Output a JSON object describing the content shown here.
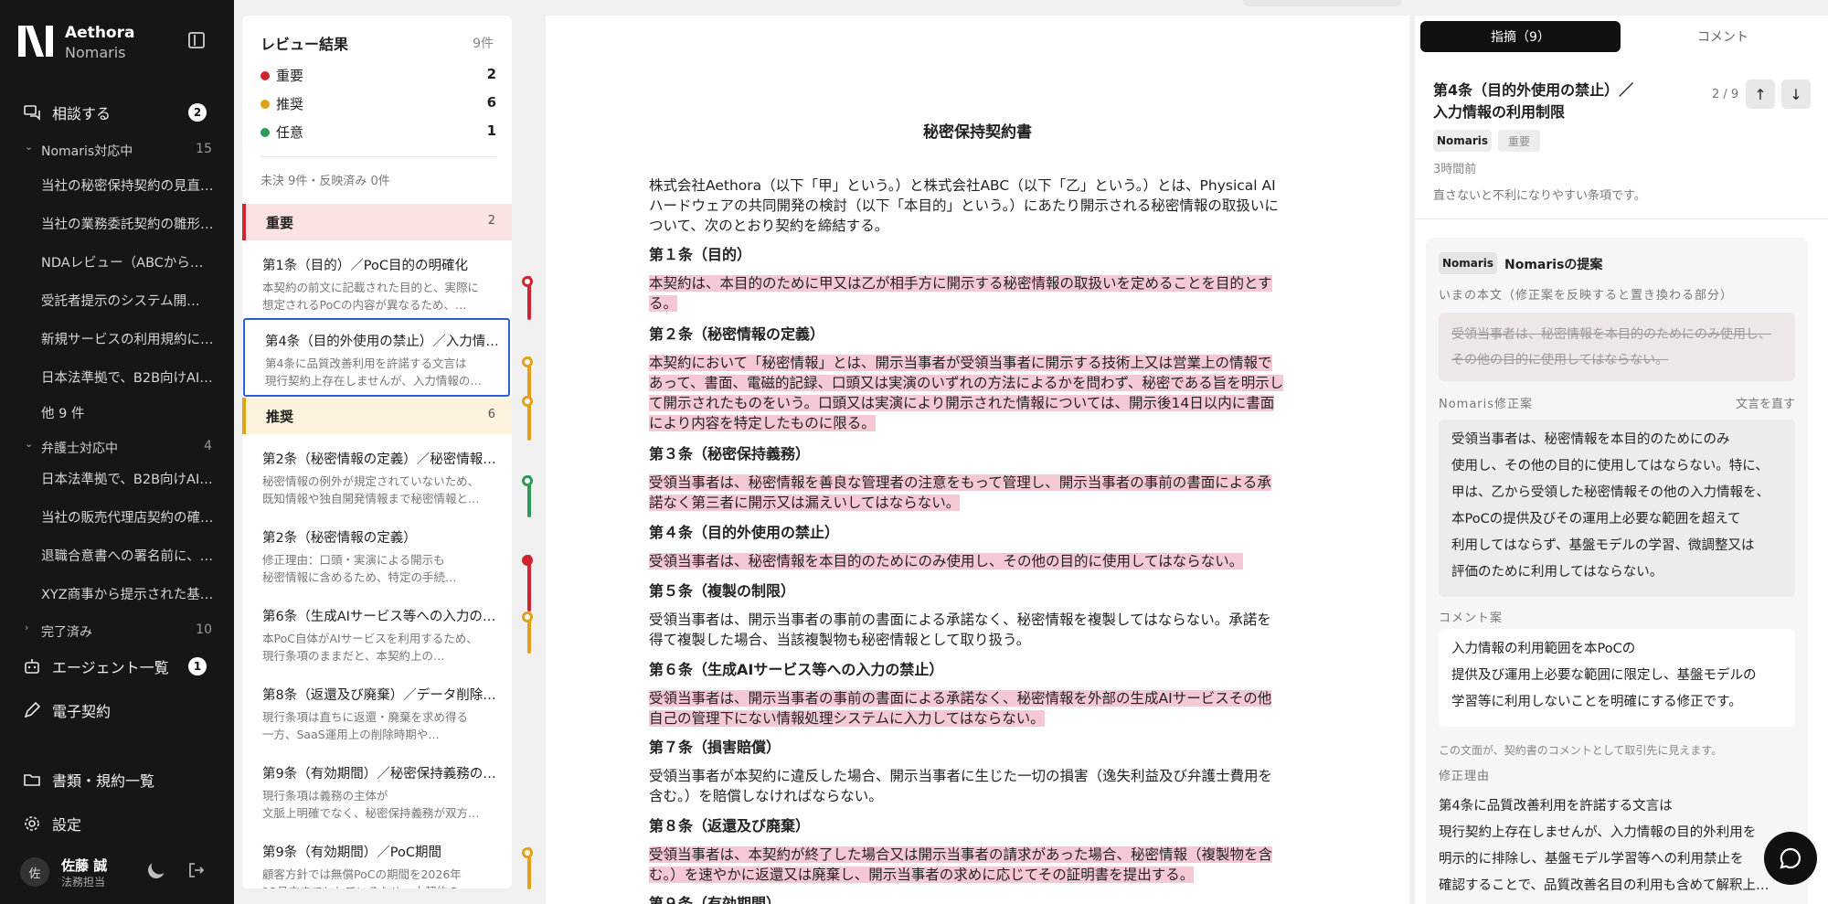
{
  "brand": {
    "name": "Aethora",
    "sub": "Nomaris"
  },
  "nav": {
    "consult": "相談する",
    "consult_badge": "2",
    "agents": "エージェント一覧",
    "agents_badge": "1",
    "contract": "電子契約",
    "docs": "書類・規約一覧",
    "settings": "設定"
  },
  "groups": [
    {
      "label": "Nomaris対応中",
      "count": "15",
      "items": [
        "当社の秘密保持契約の見直…",
        "当社の業務委託契約の雛形…",
        "NDAレビュー（ABCからの…",
        "受託者提示のシステム開…",
        "新規サービスの利用規約に…",
        "日本法準拠で、B2B向けAI…",
        "他 9 件"
      ]
    },
    {
      "label": "弁護士対応中",
      "count": "4",
      "items": [
        "日本法準拠で、B2B向けAI…",
        "当社の販売代理店契約の確…",
        "退職合意書への署名前に、…",
        "XYZ商事から提示された基…"
      ]
    },
    {
      "label": "完了済み",
      "count": "10",
      "items": []
    }
  ],
  "user": {
    "avatar": "佐",
    "name": "佐藤 誠",
    "role": "法務担当"
  },
  "review": {
    "title": "レビュー結果",
    "count": "9件",
    "severity": [
      {
        "label": "重要",
        "count": "2",
        "color": "#d0252f"
      },
      {
        "label": "推奨",
        "count": "6",
        "color": "#e0a21b"
      },
      {
        "label": "任意",
        "count": "1",
        "color": "#2e9a5a"
      }
    ],
    "status": "未決 9件・反映済み 0件",
    "sections": [
      {
        "label": "重要",
        "count": "2"
      },
      {
        "label": "推奨",
        "count": "6"
      }
    ],
    "items": [
      {
        "title": "第1条（目的）／PoC目的の明確化",
        "desc": "本契約の前文に記載された目的と、実際に\n想定されるPoCの内容が異なるため、…"
      },
      {
        "title": "第4条（目的外使用の禁止）／入力情…",
        "desc": "第4条に品質改善利用を許諾する文言は\n現行契約上存在しませんが、入力情報の…"
      },
      {
        "title": "第2条（秘密情報の定義）／秘密情報…",
        "desc": "秘密情報の例外が規定されていないため、\n既知情報や独自開発情報まで秘密情報と…"
      },
      {
        "title": "第2条（秘密情報の定義）",
        "desc": "修正理由：口頭・実演による開示も\n秘密情報に含めるため、特定の手続…"
      },
      {
        "title": "第6条（生成AIサービス等への入力の…",
        "desc": "本PoC自体がAIサービスを利用するため、\n現行条項のままだと、本契約上の…"
      },
      {
        "title": "第8条（返還及び廃棄）／データ削除…",
        "desc": "現行条項は直ちに返還・廃棄を求め得る\n一方、SaaS運用上の削除時期や…"
      },
      {
        "title": "第9条（有効期間）／秘密保持義務の…",
        "desc": "現行条項は義務の主体が\n文脈上明確でなく、秘密保持義務が双方…"
      },
      {
        "title": "第9条（有効期間）／PoC期間",
        "desc": "顧客方針では無償PoCの期間を2026年\n12月末までとしているため、本契約の…"
      }
    ]
  },
  "doc": {
    "title": "秘密保持契約書",
    "p0": "株式会社Aethora（以下「甲」という。）と株式会社ABC（以下「乙」という。）とは、Physical AIハードウェアの共同開発の検討（以下「本目的」という。）にあたり開示される秘密情報の取扱いについて、次のとおり契約を締結する。",
    "h1": "第１条（目的）",
    "p1": "本契約は、本目的のために甲又は乙が相手方に開示する秘密情報の取扱いを定めることを目的とする。",
    "h2": "第２条（秘密情報の定義）",
    "p2": "本契約において「秘密情報」とは、開示当事者が受領当事者に開示する技術上又は営業上の情報であって、書面、電磁的記録、口頭又は実演のいずれの方法によるかを問わず、秘密である旨を明示して開示されたものをいう。口頭又は実演により開示された情報については、開示後14日以内に書面により内容を特定したものに限る。",
    "h3": "第３条（秘密保持義務）",
    "p3": "受領当事者は、秘密情報を善良な管理者の注意をもって管理し、開示当事者の事前の書面による承諾なく第三者に開示又は漏えいしてはならない。",
    "h4": "第４条（目的外使用の禁止）",
    "p4": "受領当事者は、秘密情報を本目的のためにのみ使用し、その他の目的に使用してはならない。",
    "h5": "第５条（複製の制限）",
    "p5": "受領当事者は、開示当事者の事前の書面による承諾なく、秘密情報を複製してはならない。承諾を得て複製した場合、当該複製物も秘密情報として取り扱う。",
    "h6": "第６条（生成AIサービス等への入力の禁止）",
    "p6": "受領当事者は、開示当事者の事前の書面による承諾なく、秘密情報を外部の生成AIサービスその他自己の管理下にない情報処理システムに入力してはならない。",
    "h7": "第７条（損害賠償）",
    "p7": "受領当事者が本契約に違反した場合、開示当事者に生じた一切の損害（逸失利益及び弁護士費用を含む。）を賠償しなければならない。",
    "h8": "第８条（返還及び廃棄）",
    "p8": "受領当事者は、本契約が終了した場合又は開示当事者の請求があった場合、秘密情報（複製物を含む。）を速やかに返還又は廃棄し、開示当事者の求めに応じてその証明書を提出する。",
    "h9": "第９条（有効期間）"
  },
  "panel": {
    "tab_findings": "指摘（9）",
    "tab_comments": "コメント",
    "title": "第4条（目的外使用の禁止）／入力情報の利用制限",
    "page": "2 / 9",
    "up": "↑",
    "down": "↓",
    "chip1": "Nomaris",
    "chip2": "重要",
    "time": "3時間前",
    "desc": "直さないと不利になりやすい条項です。",
    "proposal_chip": "Nomaris",
    "proposal_title": "Nomarisの提案",
    "orig_label": "いまの本文（修正案を反映すると置き換わる部分）",
    "orig_text": "受領当事者は、秘密情報を本目的のためにのみ使用し、その他の目的に使用してはならない。",
    "fix_label": "Nomaris修正案",
    "fix_action": "文言を直す",
    "fix_text": "受領当事者は、秘密情報を本目的のためにのみ\n使用し、その他の目的に使用してはならない。特に、\n甲は、乙から受領した秘密情報その他の入力情報を、\n本PoCの提供及びその運用上必要な範囲を超えて\n利用してはならず、基盤モデルの学習、微調整又は\n評価のために利用してはならない。",
    "comment_label": "コメント案",
    "comment_text": "入力情報の利用範囲を本PoCの\n提供及び運用上必要な範囲に限定し、基盤モデルの\n学習等に利用しないことを明確にする修正です。",
    "comment_note": "この文面が、契約書のコメントとして取引先に見えます。",
    "reason_label": "修正理由",
    "reason_text": "第4条に品質改善利用を許諾する文言は\n現行契約上存在しませんが、入力情報の目的外利用を\n明示的に排除し、基盤モデル学習等への利用禁止を\n確認することで、品質改善名目の利用も含めて解釈上…"
  }
}
